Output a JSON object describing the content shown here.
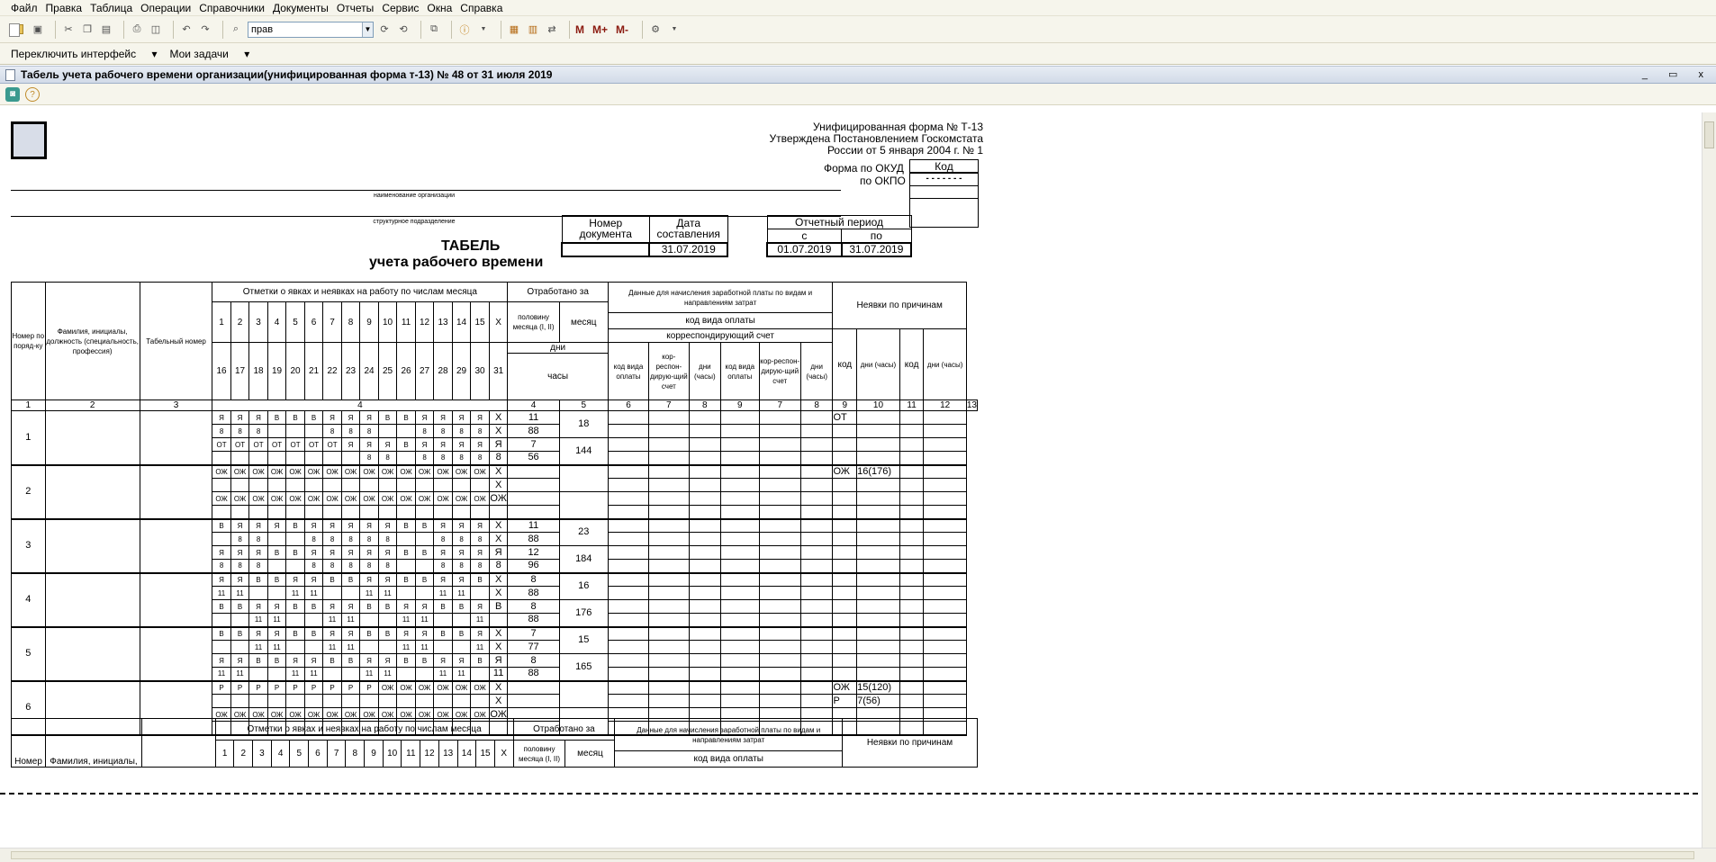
{
  "menu": [
    "Файл",
    "Правка",
    "Таблица",
    "Операции",
    "Справочники",
    "Документы",
    "Отчеты",
    "Сервис",
    "Окна",
    "Справка"
  ],
  "toolbar": {
    "search_value": "прав",
    "m": "M",
    "mplus": "M+",
    "mminus": "M-"
  },
  "bar2": {
    "switch": "Переключить интерфейс",
    "tasks": "Мои задачи"
  },
  "window": {
    "title": "Табель учета рабочего времени организации(унифицированная форма т-13) № 48 от 31 июля 2019",
    "controls": "_ ▭ x"
  },
  "form": {
    "approval": [
      "Унифицированная форма № Т-13",
      "Утверждена Постановлением Госкомстата",
      "России от 5 января 2004 г. № 1"
    ],
    "code_header": "Код",
    "okud": "Форма по ОКУД",
    "okpo": "по ОКПО",
    "org_caption": "наименование организации",
    "dept_caption": "структурное подразделение",
    "doc_number": "Номер документа",
    "doc_date": "Дата составления",
    "doc_date_value": "31.07.2019",
    "period": "Отчетный период",
    "period_from": "с",
    "period_to": "по",
    "period_from_value": "01.07.2019",
    "period_to_value": "31.07.2019",
    "title": "ТАБЕЛЬ",
    "subtitle": "учета рабочего времени"
  },
  "table": {
    "h_num": "Номер по поряд-ку",
    "h_name": "Фамилия, инициалы, должность (специальность, профессия)",
    "h_tab": "Табельный номер",
    "h_marks": "Отметки о явках и неявках на работу по числам месяца",
    "h_worked": "Отработано за",
    "h_half": "половину месяца (I, II)",
    "h_month": "месяц",
    "h_days": "дни",
    "h_hours": "часы",
    "h_pay": "Данные для начисления заработной платы по видам и направлениям затрат",
    "h_paycode": "код вида оплаты",
    "h_account": "корреспондирующий счет",
    "h_absence": "Неявки по причинам",
    "sub_code": "код вида оплаты",
    "sub_acc": "кор-респон-дирую-щий счет",
    "sub_days": "дни (часы)",
    "abs_code": "код",
    "abs_days": "дни (часы)",
    "days1": [
      "1",
      "2",
      "3",
      "4",
      "5",
      "6",
      "7",
      "8",
      "9",
      "10",
      "11",
      "12",
      "13",
      "14",
      "15",
      "X"
    ],
    "days2": [
      "16",
      "17",
      "18",
      "19",
      "20",
      "21",
      "22",
      "23",
      "24",
      "25",
      "26",
      "27",
      "28",
      "29",
      "30",
      "31"
    ],
    "index_row": [
      "1",
      "2",
      "3",
      "4",
      "5",
      "6",
      "7",
      "8",
      "9",
      "7",
      "8",
      "9",
      "10",
      "11",
      "12",
      "13"
    ],
    "employees": [
      {
        "num": "1",
        "rows": [
          [
            "Я",
            "Я",
            "Я",
            "В",
            "В",
            "В",
            "Я",
            "Я",
            "Я",
            "В",
            "В",
            "Я",
            "Я",
            "Я",
            "Я",
            "X"
          ],
          [
            "8",
            "8",
            "8",
            "",
            "",
            "",
            "8",
            "8",
            "8",
            "",
            "",
            "8",
            "8",
            "8",
            "8",
            "X"
          ],
          [
            "ОТ",
            "ОТ",
            "ОТ",
            "ОТ",
            "ОТ",
            "ОТ",
            "ОТ",
            "Я",
            "Я",
            "Я",
            "В",
            "Я",
            "Я",
            "Я",
            "Я",
            "Я"
          ],
          [
            "",
            "",
            "",
            "",
            "",
            "",
            "",
            "",
            "8",
            "8",
            "",
            "8",
            "8",
            "8",
            "8",
            "8"
          ]
        ],
        "half": [
          "11",
          "88",
          "7",
          "56"
        ],
        "month": [
          "18",
          "144"
        ],
        "abs": [
          [
            "ОТ",
            ""
          ],
          [
            "",
            ""
          ]
        ]
      },
      {
        "num": "2",
        "rows": [
          [
            "ОЖ",
            "ОЖ",
            "ОЖ",
            "ОЖ",
            "ОЖ",
            "ОЖ",
            "ОЖ",
            "ОЖ",
            "ОЖ",
            "ОЖ",
            "ОЖ",
            "ОЖ",
            "ОЖ",
            "ОЖ",
            "ОЖ",
            "X"
          ],
          [
            "",
            "",
            "",
            "",
            "",
            "",
            "",
            "",
            "",
            "",
            "",
            "",
            "",
            "",
            "",
            "X"
          ],
          [
            "ОЖ",
            "ОЖ",
            "ОЖ",
            "ОЖ",
            "ОЖ",
            "ОЖ",
            "ОЖ",
            "ОЖ",
            "ОЖ",
            "ОЖ",
            "ОЖ",
            "ОЖ",
            "ОЖ",
            "ОЖ",
            "ОЖ",
            "ОЖ"
          ],
          [
            "",
            "",
            "",
            "",
            "",
            "",
            "",
            "",
            "",
            "",
            "",
            "",
            "",
            "",
            "",
            ""
          ]
        ],
        "half": [
          "",
          "",
          "",
          ""
        ],
        "month": [
          "",
          ""
        ],
        "abs": [
          [
            "ОЖ",
            "16(176)"
          ],
          [
            "",
            ""
          ]
        ]
      },
      {
        "num": "3",
        "rows": [
          [
            "В",
            "Я",
            "Я",
            "Я",
            "В",
            "Я",
            "Я",
            "Я",
            "Я",
            "Я",
            "В",
            "В",
            "Я",
            "Я",
            "Я",
            "X"
          ],
          [
            "",
            "8",
            "8",
            "",
            "",
            "8",
            "8",
            "8",
            "8",
            "8",
            "",
            "",
            "8",
            "8",
            "8",
            "X"
          ],
          [
            "Я",
            "Я",
            "Я",
            "В",
            "В",
            "Я",
            "Я",
            "Я",
            "Я",
            "Я",
            "В",
            "В",
            "Я",
            "Я",
            "Я",
            "Я"
          ],
          [
            "8",
            "8",
            "8",
            "",
            "",
            "8",
            "8",
            "8",
            "8",
            "8",
            "",
            "",
            "8",
            "8",
            "8",
            "8"
          ]
        ],
        "half": [
          "11",
          "88",
          "12",
          "96"
        ],
        "month": [
          "23",
          "184"
        ],
        "abs": [
          [
            "",
            ""
          ],
          [
            "",
            ""
          ]
        ]
      },
      {
        "num": "4",
        "rows": [
          [
            "Я",
            "Я",
            "В",
            "В",
            "Я",
            "Я",
            "В",
            "В",
            "Я",
            "Я",
            "В",
            "В",
            "Я",
            "Я",
            "В",
            "X"
          ],
          [
            "11",
            "11",
            "",
            "",
            "11",
            "11",
            "",
            "",
            "11",
            "11",
            "",
            "",
            "11",
            "11",
            "",
            "X"
          ],
          [
            "В",
            "В",
            "Я",
            "Я",
            "В",
            "В",
            "Я",
            "Я",
            "В",
            "В",
            "Я",
            "Я",
            "В",
            "В",
            "Я",
            "В"
          ],
          [
            "",
            "",
            "11",
            "11",
            "",
            "",
            "11",
            "11",
            "",
            "",
            "11",
            "11",
            "",
            "",
            "11",
            ""
          ]
        ],
        "half": [
          "8",
          "88",
          "8",
          "88"
        ],
        "month": [
          "16",
          "176"
        ],
        "abs": [
          [
            "",
            ""
          ],
          [
            "",
            ""
          ]
        ]
      },
      {
        "num": "5",
        "rows": [
          [
            "В",
            "В",
            "Я",
            "Я",
            "В",
            "В",
            "Я",
            "Я",
            "В",
            "В",
            "Я",
            "Я",
            "В",
            "В",
            "Я",
            "X"
          ],
          [
            "",
            "",
            "11",
            "11",
            "",
            "",
            "11",
            "11",
            "",
            "",
            "11",
            "11",
            "",
            "",
            "11",
            "X"
          ],
          [
            "Я",
            "Я",
            "В",
            "В",
            "Я",
            "Я",
            "В",
            "В",
            "Я",
            "Я",
            "В",
            "В",
            "Я",
            "Я",
            "В",
            "Я"
          ],
          [
            "11",
            "11",
            "",
            "",
            "11",
            "11",
            "",
            "",
            "11",
            "11",
            "",
            "",
            "11",
            "11",
            "",
            "11"
          ]
        ],
        "half": [
          "7",
          "77",
          "8",
          "88"
        ],
        "month": [
          "15",
          "165"
        ],
        "abs": [
          [
            "",
            ""
          ],
          [
            "",
            ""
          ]
        ]
      },
      {
        "num": "6",
        "rows": [
          [
            "Р",
            "Р",
            "Р",
            "Р",
            "Р",
            "Р",
            "Р",
            "Р",
            "Р",
            "ОЖ",
            "ОЖ",
            "ОЖ",
            "ОЖ",
            "ОЖ",
            "ОЖ",
            "X"
          ],
          [
            "",
            "",
            "",
            "",
            "",
            "",
            "",
            "",
            "",
            "",
            "",
            "",
            "",
            "",
            "",
            "X"
          ],
          [
            "ОЖ",
            "ОЖ",
            "ОЖ",
            "ОЖ",
            "ОЖ",
            "ОЖ",
            "ОЖ",
            "ОЖ",
            "ОЖ",
            "ОЖ",
            "ОЖ",
            "ОЖ",
            "ОЖ",
            "ОЖ",
            "ОЖ",
            "ОЖ"
          ],
          [
            "",
            "",
            "",
            "",
            "",
            "",
            "",
            "",
            "",
            "",
            "",
            "",
            "",
            "",
            "",
            ""
          ]
        ],
        "half": [
          "",
          "",
          "",
          ""
        ],
        "month": [
          "",
          ""
        ],
        "abs": [
          [
            "ОЖ",
            "15(120)"
          ],
          [
            "Р",
            "7(56)"
          ]
        ]
      }
    ]
  },
  "table2": {
    "h_num": "Номер",
    "h_name": "Фамилия, инициалы,",
    "h_marks": "Отметки о явках и неявках на работу по числам месяца",
    "h_worked": "Отработано за",
    "h_half": "половину месяца (I, II)",
    "h_month": "месяц",
    "h_pay": "Данные для начисления заработной платы по видам и направлениям затрат",
    "h_paycode": "код вида оплаты",
    "h_absence": "Неявки по причинам"
  }
}
